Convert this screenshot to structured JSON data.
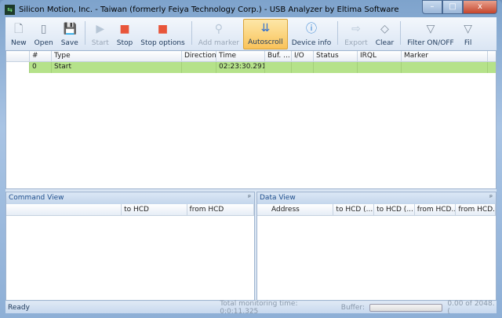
{
  "window": {
    "title": "Silicon Motion, Inc. - Taiwan (formerly Feiya Technology Corp.) - USB Analyzer by Eltima Software",
    "min": "–",
    "max": "□",
    "close": "x"
  },
  "toolbar": [
    {
      "label": "New",
      "icon": "new-file-icon",
      "glyph": "🗋",
      "enabled": true
    },
    {
      "label": "Open",
      "icon": "open-icon",
      "glyph": "▯",
      "enabled": true
    },
    {
      "label": "Save",
      "icon": "save-icon",
      "glyph": "💾",
      "enabled": true
    },
    {
      "label": "Start",
      "icon": "play-icon",
      "glyph": "▶",
      "enabled": false
    },
    {
      "label": "Stop",
      "icon": "stop-icon",
      "glyph": "■",
      "enabled": true
    },
    {
      "label": "Stop options",
      "icon": "stop-options-icon",
      "glyph": "■",
      "enabled": true
    },
    {
      "label": "Add marker",
      "icon": "marker-icon",
      "glyph": "⚲",
      "enabled": false
    },
    {
      "label": "Autoscroll",
      "icon": "autoscroll-icon",
      "glyph": "⇊",
      "enabled": true,
      "active": true
    },
    {
      "label": "Device info",
      "icon": "info-icon",
      "glyph": "ⓘ",
      "enabled": true
    },
    {
      "label": "Export",
      "icon": "export-icon",
      "glyph": "⇨",
      "enabled": false
    },
    {
      "label": "Clear",
      "icon": "eraser-icon",
      "glyph": "◇",
      "enabled": true
    },
    {
      "label": "Filter ON/OFF",
      "icon": "filter-icon",
      "glyph": "▽",
      "enabled": true
    },
    {
      "label": "Fil",
      "icon": "filter-icon",
      "glyph": "▽",
      "enabled": true
    }
  ],
  "grid": {
    "columns": [
      "",
      "#",
      "Type",
      "Direction",
      "Time",
      "Buf. ...",
      "I/O",
      "Status",
      "IRQL",
      "Marker"
    ],
    "rows": [
      [
        "",
        "0",
        "Start",
        "",
        "02:23:30.291",
        "",
        "",
        "",
        "",
        ""
      ]
    ]
  },
  "command_view": {
    "title": "Command View",
    "columns": [
      "",
      "to HCD",
      "from HCD"
    ]
  },
  "data_view": {
    "title": "Data View",
    "columns": [
      "Address",
      "to HCD (...",
      "to HCD (...",
      "from HCD...",
      "from HCD..."
    ]
  },
  "status": {
    "text": "Ready",
    "monitoring": "Total monitoring time: 0:0:11.325",
    "buffer_label": "Buffer:",
    "buffer_fill": 0,
    "buffer_text": "0.00 of 2048.("
  }
}
